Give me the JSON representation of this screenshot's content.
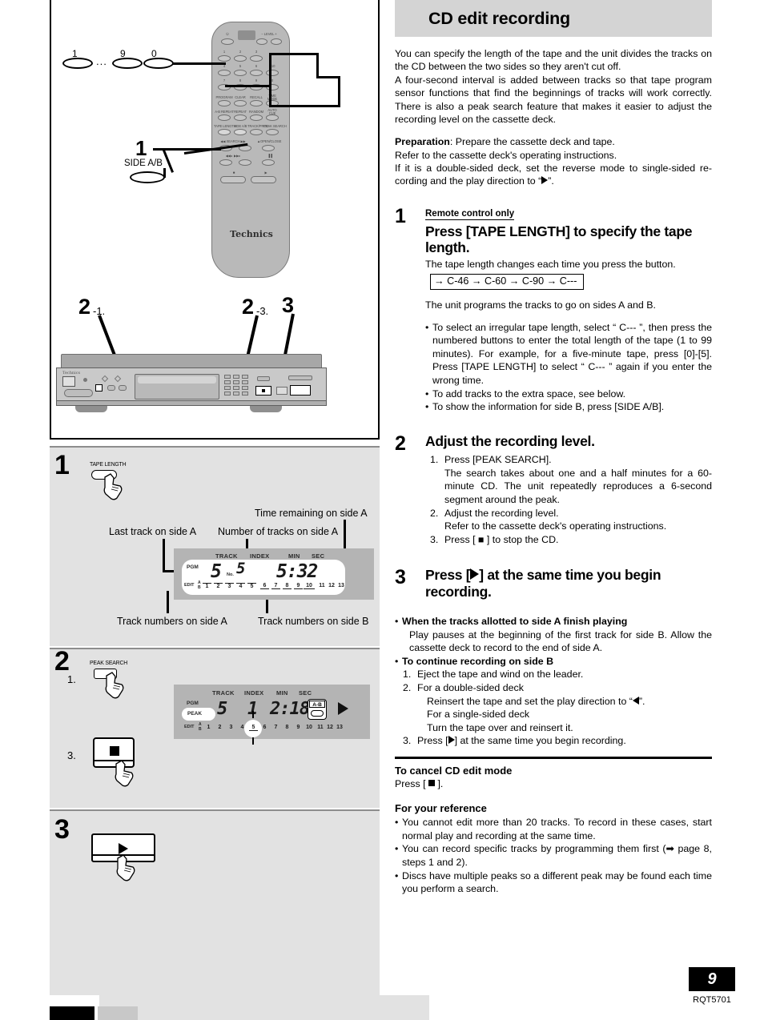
{
  "document": {
    "page_number": "9",
    "doc_code": "RQT5701"
  },
  "right": {
    "title": "CD edit recording",
    "intro": [
      "You can specify the length of the tape and the unit divides the tracks on the CD between the two sides so they aren't cut off.",
      "A four-second interval is added between tracks so that tape program sensor functions that find the beginnings of tracks will work correctly. There is also a peak search feature that makes it easier to adjust the recording level on the cassette deck."
    ],
    "preparation": {
      "label": "Preparation",
      "line1": ": Prepare the cassette deck and tape.",
      "line2": "Refer to the cassette deck's operating instructions.",
      "line3": "If it is a double-sided deck, set the reverse mode to single-sided re-cording and the play direction to “",
      "line3_end": "”."
    },
    "step1": {
      "number": "1",
      "badge": "Remote control only",
      "heading": "Press [TAPE LENGTH] to specify the tape length.",
      "sub": "The tape length changes each time you press the button.",
      "cycle": "→ C-46 → C-60 → C-90 → C---",
      "after_cycle": "The unit programs the tracks to go on sides A and B.",
      "bullets": [
        "To select an irregular tape length, select “ C--- ”, then press the numbered buttons to enter the total length of the tape (1 to 99 minutes). For example, for a five-minute tape, press [0]-[5]. Press [TAPE LENGTH] to select “ C--- ” again if you enter the wrong time.",
        "To add tracks to the extra space, see below.",
        "To show the information for side B, press [SIDE A/B]."
      ]
    },
    "step2": {
      "number": "2",
      "heading": "Adjust the recording level.",
      "items": [
        {
          "mark": "1.",
          "text": "Press [PEAK SEARCH]."
        },
        {
          "mark": "",
          "text": "The search takes about one and a half minutes for a 60-minute CD. The unit repeatedly reproduces a 6-second segment around the peak."
        },
        {
          "mark": "2.",
          "text": "Adjust the recording level."
        },
        {
          "mark": "",
          "text": "Refer to the cassette deck's operating instructions."
        },
        {
          "mark": "3.",
          "text": "Press [ ■ ] to stop the CD."
        }
      ]
    },
    "step3": {
      "number": "3",
      "heading_pre": "Press [",
      "heading_post": "] at the same time you begin recording."
    },
    "notes": {
      "b1_head": "When the tracks allotted to side A finish playing",
      "b1_body": "Play pauses at the beginning of the first track for side B. Allow the cassette deck to record to the end of side A.",
      "b2_head": "To continue recording on side B",
      "b2_items": [
        "Eject the tape and wind on the leader.",
        "For a double-sided deck"
      ],
      "b2_sub": [
        "Reinsert the tape and set the play direction to “",
        "”.",
        "For a single-sided deck",
        "Turn the tape over and reinsert it."
      ],
      "b2_item3_pre": "Press [",
      "b2_item3_post": "] at the same time you begin recording."
    },
    "cancel": {
      "head": "To cancel CD edit mode",
      "body_pre": "Press [",
      "body_post": "]."
    },
    "reference": {
      "head": "For your reference",
      "bullets": [
        "You cannot edit more than 20 tracks. To record in these cases, start normal play and recording at the same time.",
        "You can record specific tracks by programming them first (➡ page 8, steps 1 and 2).",
        "Discs have multiple peaks so a different peak may be found each time you perform a search."
      ]
    }
  },
  "left": {
    "remote": {
      "brand": "Technics",
      "numeric_label_1": "1",
      "numeric_dots": "∙∙∙",
      "numeric_label_9": "9",
      "numeric_label_0": "0",
      "callout_1": "1",
      "side_ab_label": "SIDE A/B",
      "keypad": [
        "1",
        "2",
        "3",
        "4",
        "5",
        "6",
        "7",
        "8",
        "9",
        "0"
      ],
      "row_labels": [
        [
          "PROGRAM",
          "CLEAR",
          "RECALL",
          "TIME MODE"
        ],
        [
          "A-B REPEAT",
          "REPEAT",
          "RANDOM",
          "AUTO CUE"
        ],
        [
          "TAPE LENGTH",
          "SIDE A/B",
          "TRACK/PROG",
          "PEAK SEARCH"
        ]
      ],
      "top_labels": [
        "⏻",
        "LEVEL"
      ],
      "search_label": "SEARCH",
      "open_close_label": "OPEN/CLOSE",
      "plus10_label": "≥10"
    },
    "player": {
      "callout_2_1_big": "2",
      "callout_2_1_sub": "-1.",
      "callout_2_3_big": "2",
      "callout_2_3_sub": "-3.",
      "callout_3": "3",
      "brand": "Technics"
    },
    "panel1": {
      "step": "1",
      "button_label": "TAPE LENGTH",
      "callouts": {
        "time_remaining": "Time remaining on side A",
        "last_track": "Last track on side A",
        "num_tracks": "Number of tracks on side A",
        "tracks_a": "Track numbers on side A",
        "tracks_b": "Track numbers on side B"
      },
      "display": {
        "headers": [
          "TRACK",
          "INDEX",
          "MIN",
          "SEC"
        ],
        "pgm": "PGM",
        "edit": "EDIT",
        "edit_ab": [
          "A",
          "B"
        ],
        "track_value": "5",
        "no_label": "No.",
        "no_value": "5",
        "time_value": "5:32",
        "track_list": [
          "1",
          "2",
          "3",
          "4",
          "5",
          "6",
          "7",
          "8",
          "9",
          "10",
          "11",
          "12",
          "13"
        ],
        "side_a_tracks": [
          "1",
          "2",
          "3",
          "4",
          "5"
        ],
        "side_b_tracks": [
          "6",
          "7",
          "8",
          "9",
          "10"
        ]
      }
    },
    "panel2": {
      "step": "2",
      "sub1": "1.",
      "sub3": "3.",
      "button_label": "PEAK SEARCH",
      "display": {
        "headers": [
          "TRACK",
          "INDEX",
          "MIN",
          "SEC"
        ],
        "pgm": "PGM",
        "peak": "PEAK",
        "edit": "EDIT",
        "edit_ab": [
          "A",
          "B"
        ],
        "track_value": "5",
        "index_value": "1",
        "time_value": "2:18",
        "ab_badge": "A-B",
        "track_list": [
          "1",
          "2",
          "3",
          "4",
          "5",
          "6",
          "7",
          "8",
          "9",
          "10",
          "11",
          "12",
          "13"
        ],
        "blinking_track": "5"
      }
    },
    "panel3": {
      "step": "3"
    }
  },
  "colors": {
    "title_bar": "#d4d4d4",
    "panel_bg": "#e2e2e2",
    "display_bg": "#b4b4b4",
    "remote_body": "#b9b9b9"
  }
}
